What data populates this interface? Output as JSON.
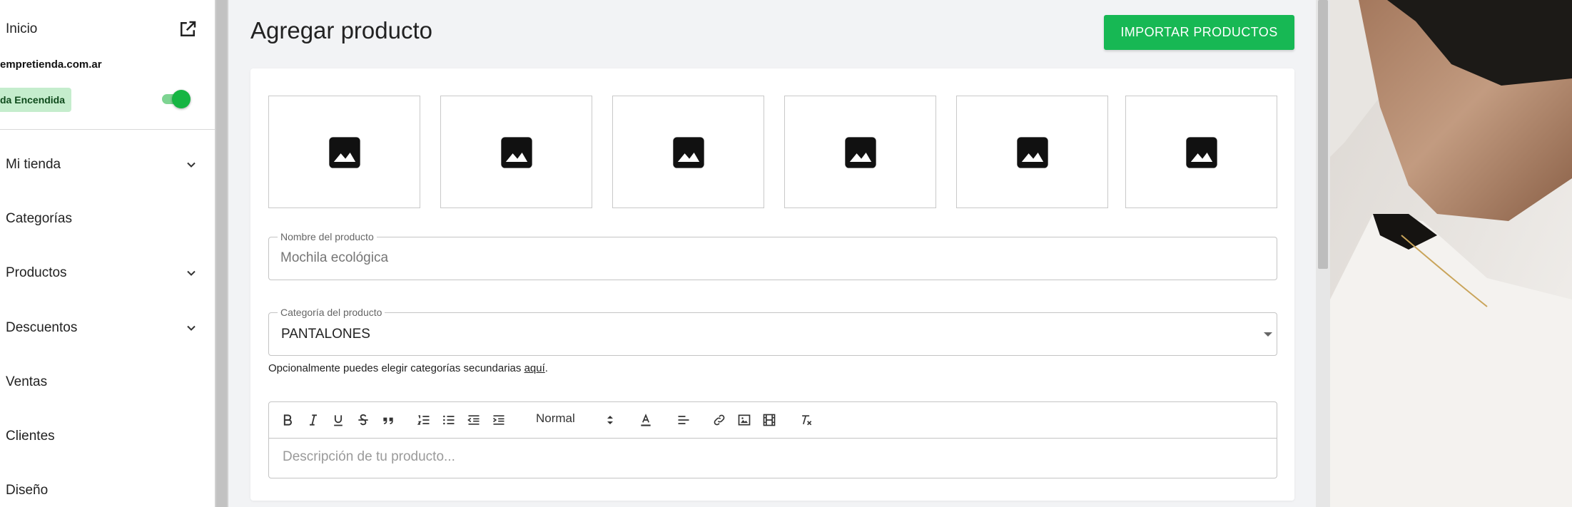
{
  "sidebar": {
    "home_label": "Inicio",
    "domain": "empretienda.com.ar",
    "store_status_badge": "da Encendida",
    "store_toggle_on": true,
    "items": [
      {
        "label": "Mi tienda",
        "has_submenu": true
      },
      {
        "label": "Categorías",
        "has_submenu": false
      },
      {
        "label": "Productos",
        "has_submenu": true
      },
      {
        "label": "Descuentos",
        "has_submenu": true
      },
      {
        "label": "Ventas",
        "has_submenu": false
      },
      {
        "label": "Clientes",
        "has_submenu": false
      },
      {
        "label": "Diseño",
        "has_submenu": false
      }
    ]
  },
  "page": {
    "title": "Agregar producto",
    "import_button": "IMPORTAR PRODUCTOS"
  },
  "form": {
    "image_slots": 6,
    "name_field": {
      "label": "Nombre del producto",
      "placeholder": "Mochila ecológica",
      "value": ""
    },
    "category_field": {
      "label": "Categoría del producto",
      "value": "PANTALONES"
    },
    "helper_text": "Opcionalmente puedes elegir categorías secundarias ",
    "helper_link": "aquí",
    "helper_end": ".",
    "editor": {
      "format_select": "Normal",
      "placeholder": "Descripción de tu producto...",
      "tools": [
        "bold",
        "italic",
        "underline",
        "strikethrough",
        "blockquote",
        "ordered-list",
        "bullet-list",
        "outdent",
        "indent",
        "text-color",
        "align",
        "link",
        "image",
        "video",
        "clear-format"
      ]
    }
  },
  "colors": {
    "accent_green": "#17b854",
    "badge_bg": "#c5edcd",
    "toggle_thumb": "#16b543"
  }
}
